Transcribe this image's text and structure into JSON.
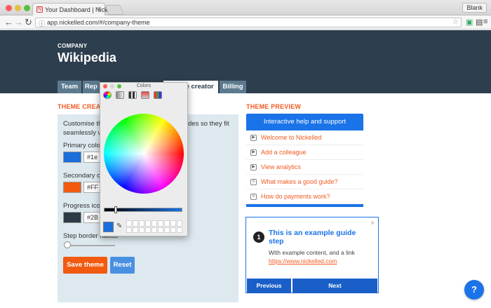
{
  "browser": {
    "tab_title": "Your Dashboard | Nickelled",
    "tab_close": "×",
    "profile_label": "Blank",
    "url": "app.nickelled.com/#/company-theme",
    "back": "←",
    "forward": "→",
    "reload": "↻"
  },
  "header": {
    "company_label": "COMPANY",
    "company_name": "Wikipedia",
    "tabs": [
      {
        "label": "Team"
      },
      {
        "label": "Rep"
      },
      {
        "label": "Theme creator"
      },
      {
        "label": "Billing"
      }
    ]
  },
  "theme_creator": {
    "title": "THEME CREAT",
    "intro_line1": "Customise th",
    "intro_line1b": "des so they fit",
    "intro_line2": "seamlessly w",
    "primary_label": "Primary colo",
    "primary_value": "#1e",
    "primary_color": "#1a6fd8",
    "secondary_label": "Secondary c",
    "secondary_value": "#FF",
    "secondary_color": "#f15a0f",
    "progress_label": "Progress ico",
    "progress_value": "#2B",
    "progress_color": "#2b3a45",
    "border_label": "Step border radius",
    "border_radius_fraction": 0.0,
    "save_label": "Save theme",
    "reset_label": "Reset"
  },
  "theme_preview": {
    "title": "THEME PREVIEW",
    "header": "Interactive help and support",
    "items": [
      {
        "label": "Welcome to Nickelled",
        "icon": "play-icon"
      },
      {
        "label": "Add a colleague",
        "icon": "play-icon"
      },
      {
        "label": "View analytics",
        "icon": "play-icon"
      },
      {
        "label": "What makes a good guide?",
        "icon": "doc-icon"
      },
      {
        "label": "How do payments work?",
        "icon": "doc-icon"
      }
    ],
    "tooltip": {
      "step_number": "1",
      "title": "This is an example guide step",
      "body": "With example content, and a link",
      "link": "https://www.nickelled.com",
      "close": "×",
      "prev_label": "Previous",
      "next_label": "Next"
    }
  },
  "help_button": "?",
  "colors_dialog": {
    "title": "Colors",
    "selected_color": "#1a6fe0"
  }
}
